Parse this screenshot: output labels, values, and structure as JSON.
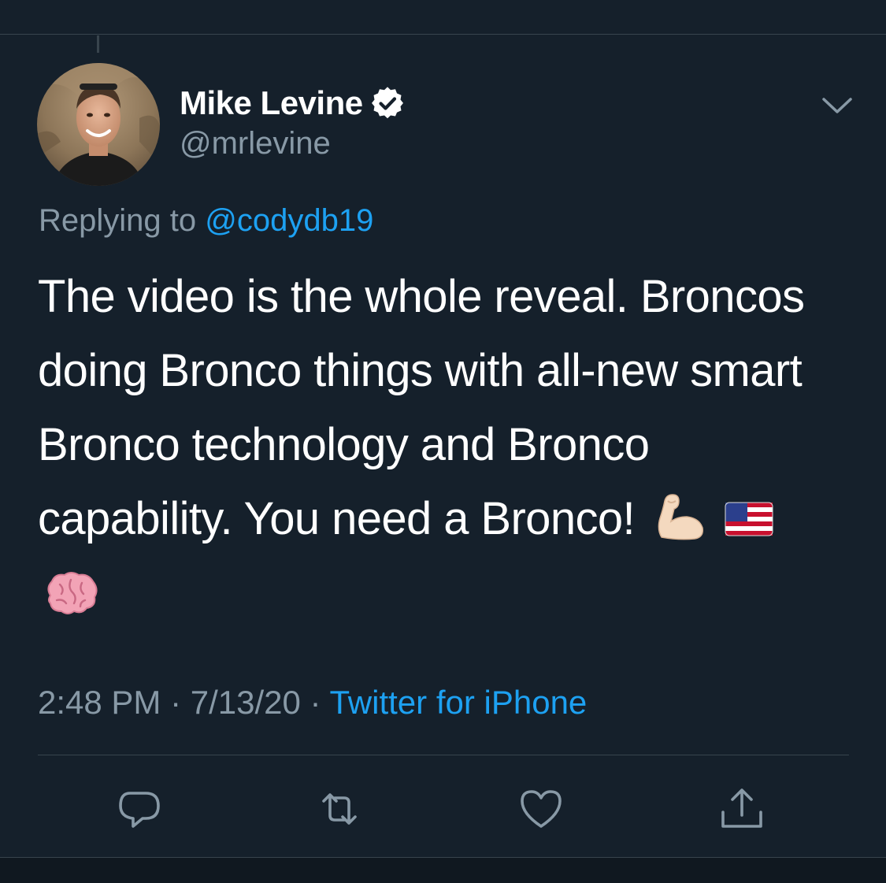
{
  "tweet": {
    "author": {
      "name": "Mike Levine",
      "handle": "@mrlevine",
      "verified": true
    },
    "reply_to": {
      "prefix": "Replying to ",
      "handle": "@codydb19"
    },
    "text": "The video is the whole reveal. Broncos doing Bronco things with all-new smart Bronco technology and Bronco capability. You need a Bronco!",
    "emojis": [
      "flexed-biceps",
      "us-flag",
      "brain"
    ],
    "meta": {
      "time": "2:48 PM",
      "separator": " · ",
      "date": "7/13/20",
      "source": "Twitter for iPhone"
    },
    "actions": [
      "reply-icon",
      "retweet-icon",
      "like-icon",
      "share-icon"
    ]
  },
  "colors": {
    "background": "#15202b",
    "divider": "#38444d",
    "secondary_text": "#8899a6",
    "accent": "#1da1f2"
  }
}
